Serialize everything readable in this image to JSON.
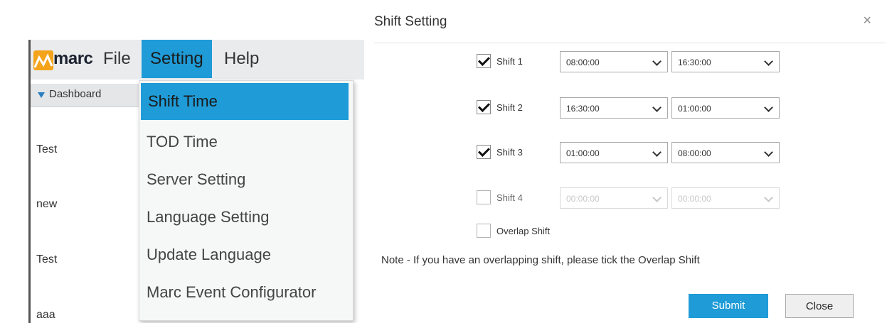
{
  "app": {
    "logo_text": "marc",
    "menu": {
      "file": "File",
      "setting": "Setting",
      "help": "Help"
    },
    "dashboard_label": "Dashboard",
    "list_items": [
      "Test",
      "new",
      "Test",
      "aaa"
    ],
    "dropdown": [
      "Shift Time",
      "TOD Time",
      "Server Setting",
      "Language Setting",
      "Update Language",
      "Marc Event Configurator"
    ]
  },
  "dialog": {
    "title": "Shift Setting",
    "close_glyph": "×",
    "shifts": [
      {
        "label": "Shift 1",
        "checked": true,
        "start": "08:00:00",
        "end": "16:30:00",
        "enabled": true
      },
      {
        "label": "Shift 2",
        "checked": true,
        "start": "16:30:00",
        "end": "01:00:00",
        "enabled": true
      },
      {
        "label": "Shift 3",
        "checked": true,
        "start": "01:00:00",
        "end": "08:00:00",
        "enabled": true
      },
      {
        "label": "Shift 4",
        "checked": false,
        "start": "00:00:00",
        "end": "00:00:00",
        "enabled": false
      }
    ],
    "overlap_label": "Overlap Shift",
    "note": "Note - If you have an overlapping shift, please tick the Overlap Shift",
    "submit": "Submit",
    "close": "Close"
  },
  "colors": {
    "accent": "#1f9bd7",
    "logo": "#f4a41b"
  }
}
